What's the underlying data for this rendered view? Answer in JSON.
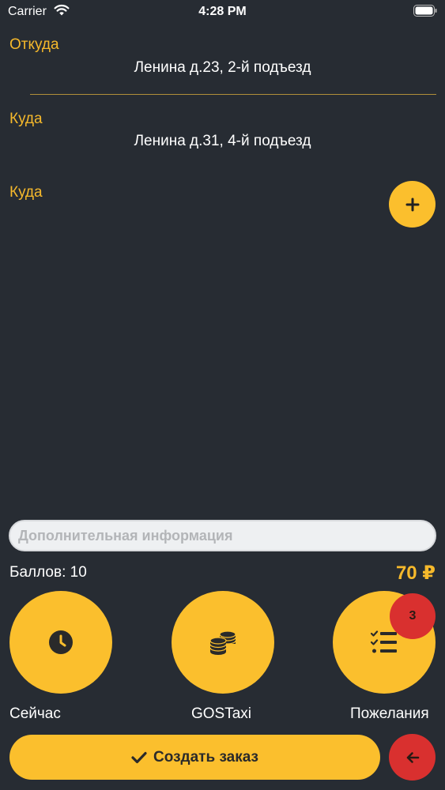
{
  "status_bar": {
    "carrier": "Carrier",
    "time": "4:28 PM"
  },
  "route": {
    "from_label": "Откуда",
    "from_address": "Ленина д.23, 2-й подъезд",
    "to_label": "Куда",
    "to_address": "Ленина д.31, 4-й подъезд",
    "extra_to_label": "Куда"
  },
  "info": {
    "placeholder": "Дополнительная информация"
  },
  "summary": {
    "points": "Баллов: 10",
    "price": "70 ₽"
  },
  "options": {
    "time_label": "Сейчас",
    "tariff_label": "GOSTaxi",
    "wishes_label": "Пожелания",
    "wishes_badge": "3"
  },
  "actions": {
    "create_label": "Создать заказ"
  },
  "colors": {
    "accent": "#fbbf2d",
    "danger": "#d9302f",
    "background": "#272c33",
    "label": "#f6b92b"
  },
  "icons": [
    "wifi-icon",
    "battery-icon",
    "plus-icon",
    "clock-icon",
    "coins-icon",
    "checklist-icon",
    "check-icon",
    "arrow-left-icon"
  ]
}
